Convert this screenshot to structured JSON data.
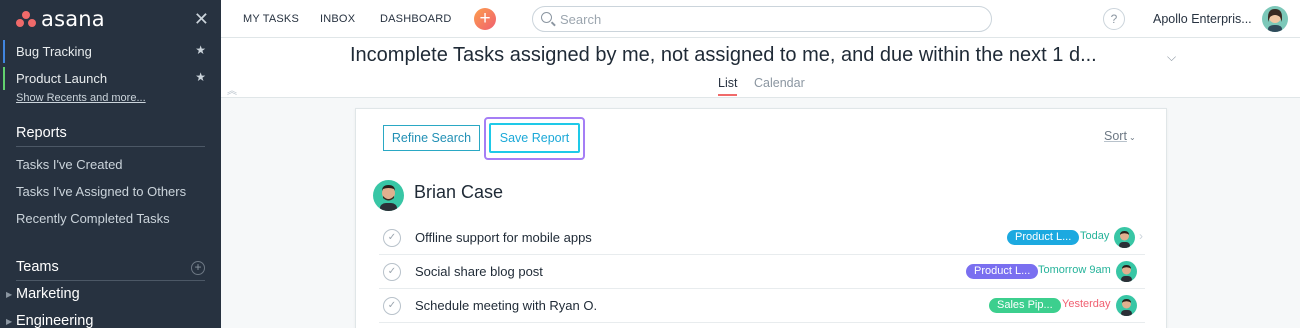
{
  "sidebar": {
    "logo": "asana",
    "favorites": [
      {
        "label": "Bug Tracking",
        "color": "#4186e0"
      },
      {
        "label": "Product Launch",
        "color": "#62d26f"
      }
    ],
    "show_recents": "Show Recents and more...",
    "reports_title": "Reports",
    "reports": [
      "Tasks I've Created",
      "Tasks I've Assigned to Others",
      "Recently Completed Tasks"
    ],
    "teams_title": "Teams",
    "teams": [
      "Marketing",
      "Engineering"
    ]
  },
  "topbar": {
    "nav": [
      "MY TASKS",
      "INBOX",
      "DASHBOARD"
    ],
    "add": "+",
    "search_placeholder": "Search",
    "help": "?",
    "org": "Apollo Enterpris..."
  },
  "header": {
    "title": "Incomplete Tasks assigned by me, not assigned to me, and due within the next 1 d...",
    "tabs": [
      "List",
      "Calendar"
    ]
  },
  "card": {
    "refine_label": "Refine Search",
    "save_label": "Save Report",
    "sort_label": "Sort",
    "assignee": "Brian Case",
    "tasks": [
      {
        "name": "Offline support for mobile apps",
        "tag": "Product L...",
        "tag_color": "#1ca9e0",
        "due": "Today",
        "due_color": "#25b39a"
      },
      {
        "name": "Social share blog post",
        "tag": "Product L...",
        "tag_color": "#7a6ff0",
        "due": "Tomorrow 9am",
        "due_color": "#25b39a"
      },
      {
        "name": "Schedule meeting with Ryan O.",
        "tag": "Sales Pip...",
        "tag_color": "#3ccf8e",
        "due": "Yesterday",
        "due_color": "#f05f70"
      }
    ]
  },
  "colors": {
    "sidebar_bg": "#273240",
    "accent": "#f06a6a",
    "focus_ring": "#a57ef5",
    "save_border": "#1ec9e8"
  }
}
